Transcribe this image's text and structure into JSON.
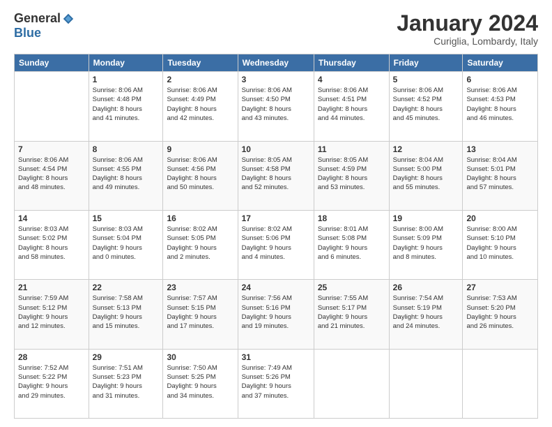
{
  "header": {
    "logo_general": "General",
    "logo_blue": "Blue",
    "month_title": "January 2024",
    "subtitle": "Curiglia, Lombardy, Italy"
  },
  "days_of_week": [
    "Sunday",
    "Monday",
    "Tuesday",
    "Wednesday",
    "Thursday",
    "Friday",
    "Saturday"
  ],
  "weeks": [
    [
      {
        "num": "",
        "info": ""
      },
      {
        "num": "1",
        "info": "Sunrise: 8:06 AM\nSunset: 4:48 PM\nDaylight: 8 hours\nand 41 minutes."
      },
      {
        "num": "2",
        "info": "Sunrise: 8:06 AM\nSunset: 4:49 PM\nDaylight: 8 hours\nand 42 minutes."
      },
      {
        "num": "3",
        "info": "Sunrise: 8:06 AM\nSunset: 4:50 PM\nDaylight: 8 hours\nand 43 minutes."
      },
      {
        "num": "4",
        "info": "Sunrise: 8:06 AM\nSunset: 4:51 PM\nDaylight: 8 hours\nand 44 minutes."
      },
      {
        "num": "5",
        "info": "Sunrise: 8:06 AM\nSunset: 4:52 PM\nDaylight: 8 hours\nand 45 minutes."
      },
      {
        "num": "6",
        "info": "Sunrise: 8:06 AM\nSunset: 4:53 PM\nDaylight: 8 hours\nand 46 minutes."
      }
    ],
    [
      {
        "num": "7",
        "info": "Sunrise: 8:06 AM\nSunset: 4:54 PM\nDaylight: 8 hours\nand 48 minutes."
      },
      {
        "num": "8",
        "info": "Sunrise: 8:06 AM\nSunset: 4:55 PM\nDaylight: 8 hours\nand 49 minutes."
      },
      {
        "num": "9",
        "info": "Sunrise: 8:06 AM\nSunset: 4:56 PM\nDaylight: 8 hours\nand 50 minutes."
      },
      {
        "num": "10",
        "info": "Sunrise: 8:05 AM\nSunset: 4:58 PM\nDaylight: 8 hours\nand 52 minutes."
      },
      {
        "num": "11",
        "info": "Sunrise: 8:05 AM\nSunset: 4:59 PM\nDaylight: 8 hours\nand 53 minutes."
      },
      {
        "num": "12",
        "info": "Sunrise: 8:04 AM\nSunset: 5:00 PM\nDaylight: 8 hours\nand 55 minutes."
      },
      {
        "num": "13",
        "info": "Sunrise: 8:04 AM\nSunset: 5:01 PM\nDaylight: 8 hours\nand 57 minutes."
      }
    ],
    [
      {
        "num": "14",
        "info": "Sunrise: 8:03 AM\nSunset: 5:02 PM\nDaylight: 8 hours\nand 58 minutes."
      },
      {
        "num": "15",
        "info": "Sunrise: 8:03 AM\nSunset: 5:04 PM\nDaylight: 9 hours\nand 0 minutes."
      },
      {
        "num": "16",
        "info": "Sunrise: 8:02 AM\nSunset: 5:05 PM\nDaylight: 9 hours\nand 2 minutes."
      },
      {
        "num": "17",
        "info": "Sunrise: 8:02 AM\nSunset: 5:06 PM\nDaylight: 9 hours\nand 4 minutes."
      },
      {
        "num": "18",
        "info": "Sunrise: 8:01 AM\nSunset: 5:08 PM\nDaylight: 9 hours\nand 6 minutes."
      },
      {
        "num": "19",
        "info": "Sunrise: 8:00 AM\nSunset: 5:09 PM\nDaylight: 9 hours\nand 8 minutes."
      },
      {
        "num": "20",
        "info": "Sunrise: 8:00 AM\nSunset: 5:10 PM\nDaylight: 9 hours\nand 10 minutes."
      }
    ],
    [
      {
        "num": "21",
        "info": "Sunrise: 7:59 AM\nSunset: 5:12 PM\nDaylight: 9 hours\nand 12 minutes."
      },
      {
        "num": "22",
        "info": "Sunrise: 7:58 AM\nSunset: 5:13 PM\nDaylight: 9 hours\nand 15 minutes."
      },
      {
        "num": "23",
        "info": "Sunrise: 7:57 AM\nSunset: 5:15 PM\nDaylight: 9 hours\nand 17 minutes."
      },
      {
        "num": "24",
        "info": "Sunrise: 7:56 AM\nSunset: 5:16 PM\nDaylight: 9 hours\nand 19 minutes."
      },
      {
        "num": "25",
        "info": "Sunrise: 7:55 AM\nSunset: 5:17 PM\nDaylight: 9 hours\nand 21 minutes."
      },
      {
        "num": "26",
        "info": "Sunrise: 7:54 AM\nSunset: 5:19 PM\nDaylight: 9 hours\nand 24 minutes."
      },
      {
        "num": "27",
        "info": "Sunrise: 7:53 AM\nSunset: 5:20 PM\nDaylight: 9 hours\nand 26 minutes."
      }
    ],
    [
      {
        "num": "28",
        "info": "Sunrise: 7:52 AM\nSunset: 5:22 PM\nDaylight: 9 hours\nand 29 minutes."
      },
      {
        "num": "29",
        "info": "Sunrise: 7:51 AM\nSunset: 5:23 PM\nDaylight: 9 hours\nand 31 minutes."
      },
      {
        "num": "30",
        "info": "Sunrise: 7:50 AM\nSunset: 5:25 PM\nDaylight: 9 hours\nand 34 minutes."
      },
      {
        "num": "31",
        "info": "Sunrise: 7:49 AM\nSunset: 5:26 PM\nDaylight: 9 hours\nand 37 minutes."
      },
      {
        "num": "",
        "info": ""
      },
      {
        "num": "",
        "info": ""
      },
      {
        "num": "",
        "info": ""
      }
    ]
  ]
}
